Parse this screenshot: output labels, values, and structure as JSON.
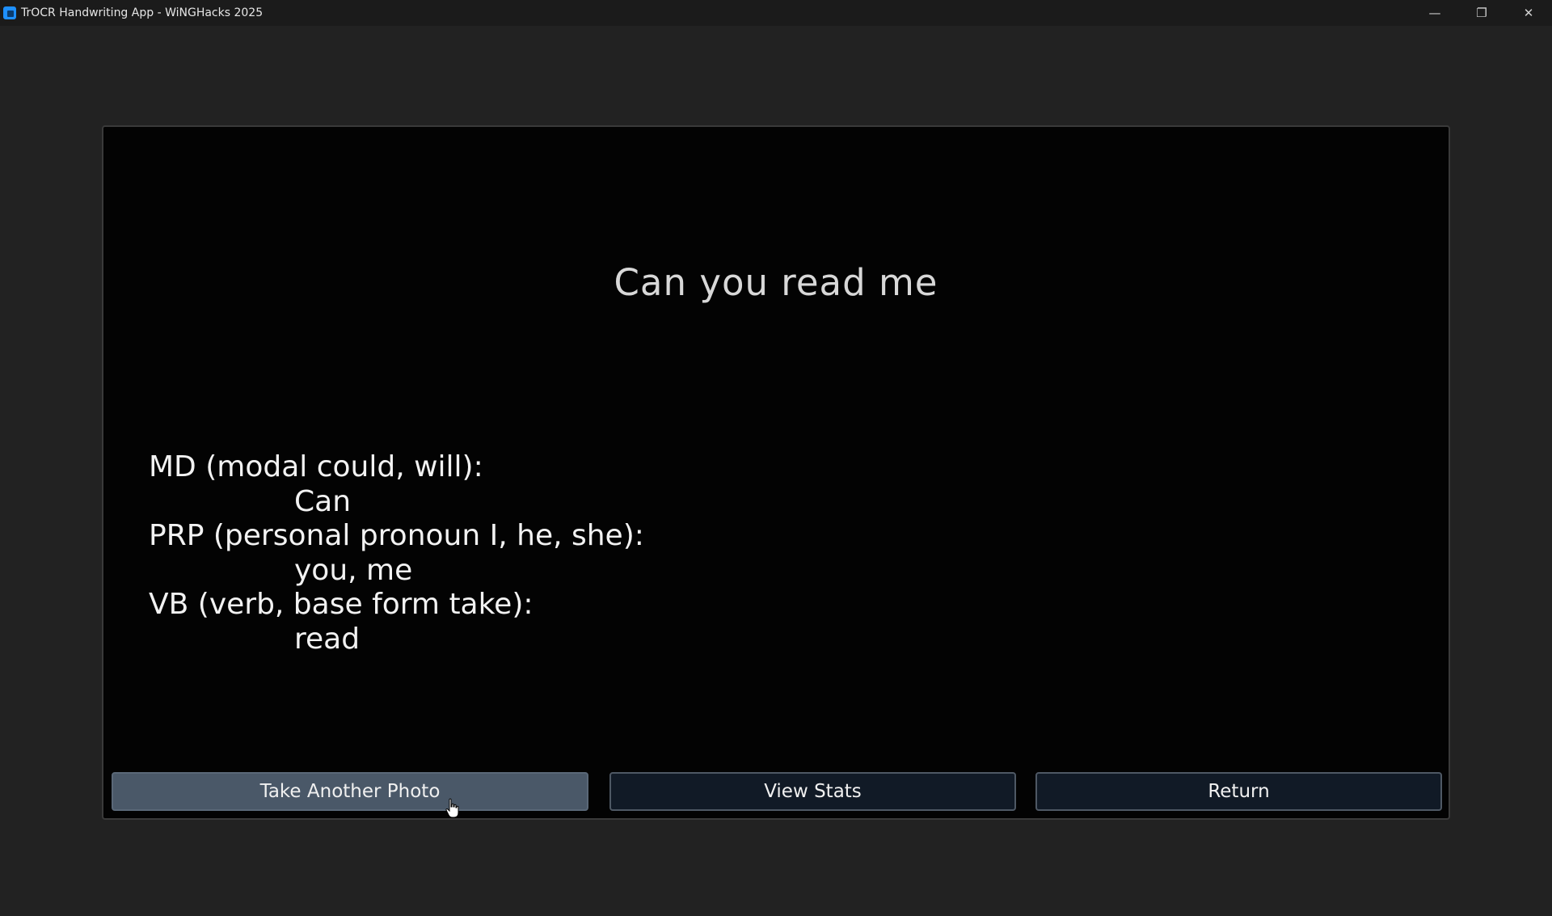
{
  "window": {
    "title": "TrOCR Handwriting App - WiNGHacks 2025",
    "controls": {
      "minimize": "—",
      "restore": "❐",
      "close": "✕"
    }
  },
  "result": {
    "sentence": "Can you read me",
    "pos_groups": [
      {
        "tag": "MD (modal could, will):",
        "words": "Can"
      },
      {
        "tag": "PRP (personal pronoun I, he, she):",
        "words": "you, me"
      },
      {
        "tag": "VB (verb, base form take):",
        "words": "read"
      }
    ]
  },
  "buttons": {
    "take_another_photo": "Take Another Photo",
    "view_stats": "View Stats",
    "return": "Return"
  },
  "colors": {
    "background": "#222222",
    "panel": "#030303",
    "button_active": "#4a5868",
    "button": "#111a26",
    "accent_icon": "#1e90ff"
  }
}
